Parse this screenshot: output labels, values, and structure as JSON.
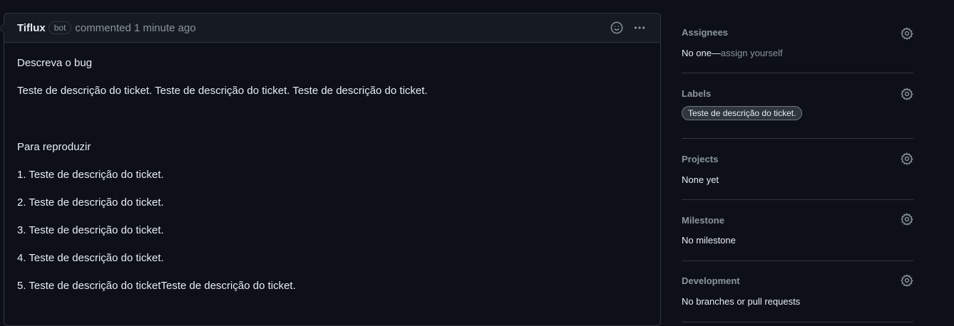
{
  "comment": {
    "author": "Tiflux",
    "badge": "bot",
    "meta": "commented 1 minute ago",
    "body": {
      "title": "Descreva o bug",
      "description": "Teste de descrição do ticket. Teste de descrição do ticket. Teste de descrição do ticket.",
      "subheading": "Para reproduzir",
      "steps": [
        "1. Teste de descrição do ticket.",
        "2. Teste de descrição do ticket.",
        "3. Teste de descrição do ticket.",
        "4. Teste de descrição do ticket.",
        "5. Teste de descrição do ticketTeste de descrição do ticket."
      ]
    }
  },
  "sidebar": {
    "assignees": {
      "title": "Assignees",
      "value": "No one—",
      "link": "assign yourself"
    },
    "labels": {
      "title": "Labels",
      "chip": "Teste de descrição do ticket."
    },
    "projects": {
      "title": "Projects",
      "value": "None yet"
    },
    "milestone": {
      "title": "Milestone",
      "value": "No milestone"
    },
    "development": {
      "title": "Development",
      "value": "No branches or pull requests"
    }
  }
}
